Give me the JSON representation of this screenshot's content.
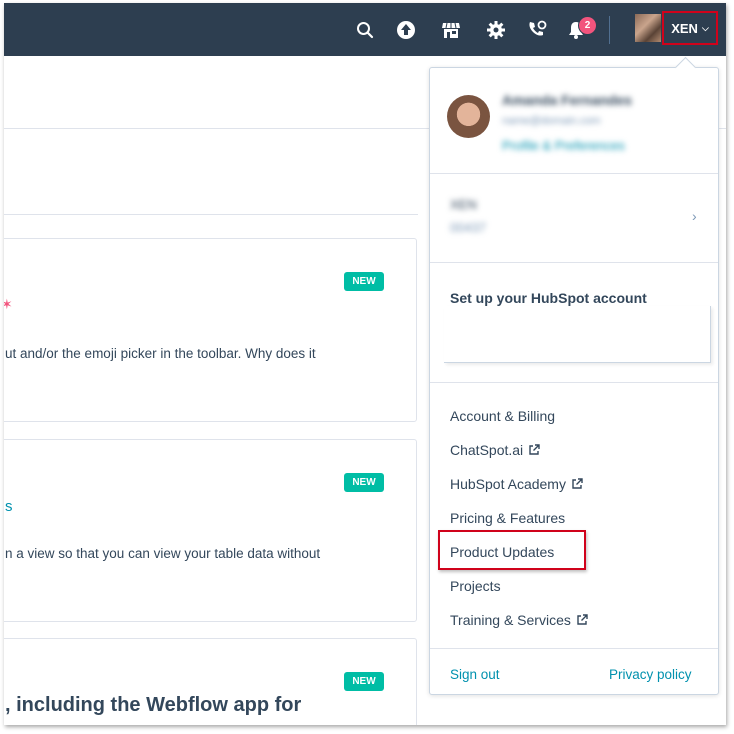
{
  "topnav": {
    "notification_count": "2",
    "account_label": "XEN"
  },
  "cards": [
    {
      "badge": "NEW",
      "text": "ut and/or the emoji picker in the toolbar. Why does it"
    },
    {
      "badge": "NEW",
      "link": "s",
      "text": "n a view so that you can view your table data without"
    },
    {
      "badge": "NEW",
      "title": ", including the Webflow app for"
    }
  ],
  "dropdown": {
    "profile": {
      "name": "Amanda Fernandes",
      "email": "name@domain.com",
      "profile_link": "Profile & Preferences"
    },
    "portal": {
      "name": "XEN",
      "id": "00437"
    },
    "setup_title": "Set up your HubSpot account",
    "menu": [
      {
        "label": "Account & Billing",
        "external": false
      },
      {
        "label": "ChatSpot.ai",
        "external": true
      },
      {
        "label": "HubSpot Academy",
        "external": true
      },
      {
        "label": "Pricing & Features",
        "external": false
      },
      {
        "label": "Product Updates",
        "external": false
      },
      {
        "label": "Projects",
        "external": false
      },
      {
        "label": "Training & Services",
        "external": true
      }
    ],
    "footer": {
      "sign_out": "Sign out",
      "privacy": "Privacy policy"
    }
  },
  "colors": {
    "nav_bg": "#2d3e50",
    "accent_teal": "#00bda5",
    "link": "#0091ae",
    "highlight": "#d0021b",
    "badge_pink": "#f2547d"
  }
}
